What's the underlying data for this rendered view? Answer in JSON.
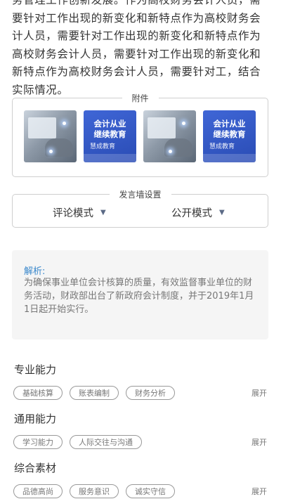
{
  "article": {
    "text": "务管理工作创新发展。作为高校财务会计人员，需要针对工作出现的新变化和新特点作为高校财务会计人员，需要针对工作出现的新变化和新特点作为高校财务会计人员，需要针对工作出现的新变化和新特点作为高校财务会计人员，需要针对工，结合实际情况。"
  },
  "attachments": {
    "legend": "附件",
    "items": [
      {
        "type": "photo",
        "icon": "photo-thumbnail"
      },
      {
        "type": "promo",
        "line1": "会计从业",
        "line2": "继续教育",
        "sub": "慧成教育"
      },
      {
        "type": "photo",
        "icon": "photo-thumbnail"
      },
      {
        "type": "promo",
        "line1": "会计从业",
        "line2": "继续教育",
        "sub": "慧成教育"
      }
    ]
  },
  "wall_settings": {
    "legend": "发言墙设置",
    "comment_mode": "评论模式",
    "visibility_mode": "公开模式",
    "caret_icon": "caret-down-icon"
  },
  "analysis": {
    "title": "解析:",
    "content": "为确保事业单位会计核算的质量，有效监督事业单位的财务活动，财政部出台了新政府会计制度，并于2019年1月1日起开始实行。"
  },
  "sections": [
    {
      "title": "专业能力",
      "tags": [
        "基础核算",
        "账表编制",
        "财务分析"
      ],
      "expand": "展开"
    },
    {
      "title": "通用能力",
      "tags": [
        "学习能力",
        "人际交往与沟通"
      ],
      "expand": "展开"
    },
    {
      "title": "综合素材",
      "tags": [
        "品德高尚",
        "服务意识",
        "诚实守信"
      ],
      "expand": "展开"
    }
  ],
  "colors": {
    "accent": "#3a88cc",
    "promo_blue": "#3458c8",
    "panel_bg": "#f5f5f5"
  }
}
